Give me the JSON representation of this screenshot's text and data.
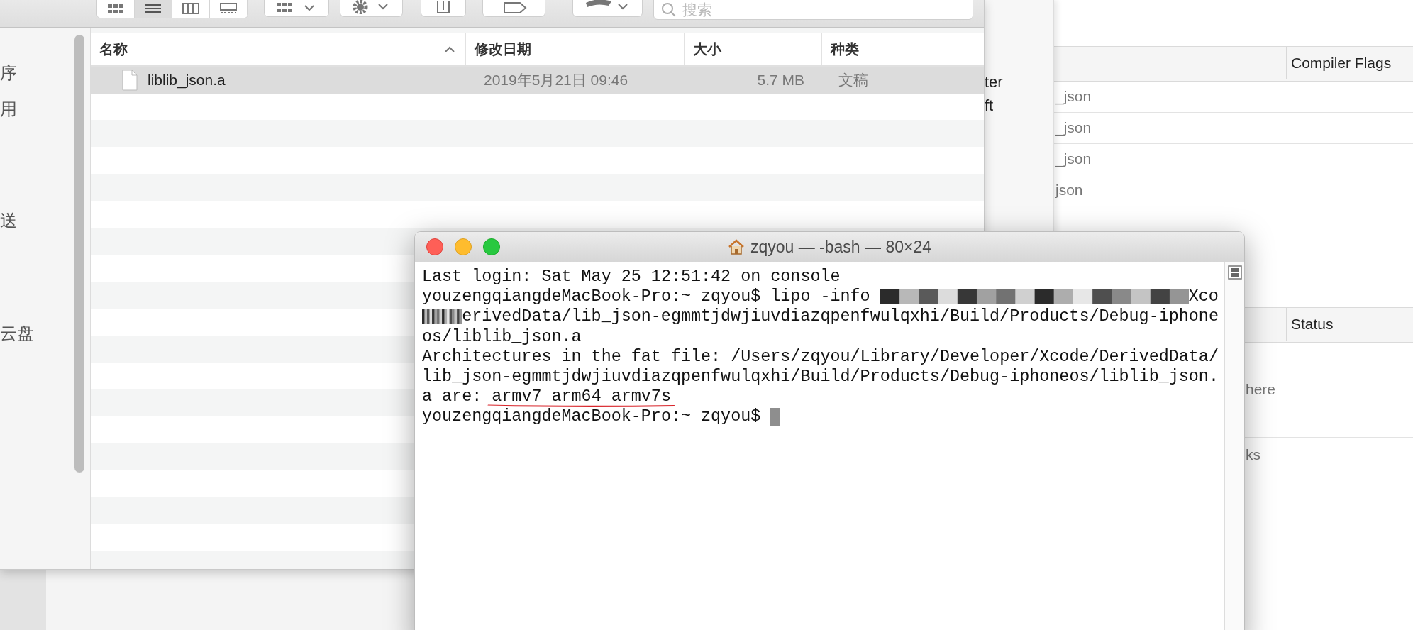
{
  "finder": {
    "toolbar": {
      "view_buttons": [
        {
          "kind": "icons",
          "selected": false
        },
        {
          "kind": "list",
          "selected": true
        },
        {
          "kind": "columns",
          "selected": false
        },
        {
          "kind": "gallery",
          "selected": false
        }
      ],
      "search": {
        "placeholder": "搜索"
      }
    },
    "sidebar": {
      "items": [
        {
          "label": "序"
        },
        {
          "label": "用"
        },
        {
          "label": "送"
        },
        {
          "label": "云盘"
        }
      ]
    },
    "columns": [
      {
        "label": "名称",
        "sorted": true
      },
      {
        "label": "修改日期",
        "sorted": false
      },
      {
        "label": "大小",
        "sorted": false
      },
      {
        "label": "种类",
        "sorted": false
      }
    ],
    "rows": [
      {
        "name": "liblib_json.a",
        "modified": "2019年5月21日 09:46",
        "size": "5.7 MB",
        "kind": "文稿",
        "selected": true
      }
    ]
  },
  "middle_window": {
    "items": [
      {
        "label": "ter"
      },
      {
        "label": "ft"
      }
    ]
  },
  "build_settings": {
    "table_1": {
      "columns": [
        "Compiler Flags"
      ],
      "rows": [
        "_json",
        "_json",
        "_json",
        "json"
      ]
    },
    "table_2": {
      "columns": [
        "Status"
      ],
      "rows": [
        "here",
        "ks"
      ]
    }
  },
  "terminal": {
    "title": "zqyou — -bash — 80×24",
    "lines": [
      {
        "segments": [
          {
            "kind": "text",
            "text": "Last login: Sat May 25 12:51:42 on console"
          }
        ]
      },
      {
        "segments": [
          {
            "kind": "text",
            "text": "youzengqiangdeMacBook-Pro:~ zqyou$ lipo -info "
          },
          {
            "kind": "redacted"
          },
          {
            "kind": "text",
            "text": "Xco"
          }
        ]
      },
      {
        "segments": [
          {
            "kind": "redacted"
          },
          {
            "kind": "text",
            "text": "erivedData/lib_json-egmmtjdwjiuvdiazqpenfwulqxhi/Build/Products/Debug-iphone"
          }
        ]
      },
      {
        "segments": [
          {
            "kind": "text",
            "text": "os/liblib_json.a"
          }
        ]
      },
      {
        "segments": [
          {
            "kind": "text",
            "text": "Architectures in the fat file: /Users/zqyou/Library/Developer/Xcode/DerivedData/"
          }
        ]
      },
      {
        "segments": [
          {
            "kind": "text",
            "text": "lib_json-egmmtjdwjiuvdiazqpenfwulqxhi/Build/Products/Debug-iphoneos/liblib_json."
          }
        ]
      },
      {
        "segments": [
          {
            "kind": "text",
            "text": "a are: "
          },
          {
            "kind": "underlined",
            "text": "armv7 arm64 armv7s"
          }
        ]
      },
      {
        "segments": [
          {
            "kind": "text",
            "text": "youzengqiangdeMacBook-Pro:~ zqyou$ "
          },
          {
            "kind": "cursor"
          }
        ]
      }
    ]
  }
}
